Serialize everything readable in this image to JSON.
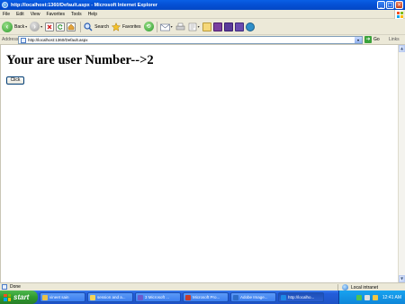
{
  "window": {
    "title": "http://localhost:1360/Default.aspx - Microsoft Internet Explorer",
    "buttons": [
      "_",
      "□",
      "×"
    ]
  },
  "menu": {
    "items": [
      "File",
      "Edit",
      "View",
      "Favorites",
      "Tools",
      "Help"
    ]
  },
  "toolbar": {
    "back_label": "Back",
    "search_label": "Search",
    "favorites_label": "Favorites"
  },
  "address": {
    "label": "Address",
    "url": "http://localhost:1360/Default.aspx",
    "go_label": "Go",
    "links_label": "Links"
  },
  "page": {
    "heading": "Your are user Number-->2",
    "button_label": "Click"
  },
  "statusbar": {
    "status": "Done",
    "zone": "Local intranet"
  },
  "taskbar": {
    "start_label": "start",
    "tasks": [
      {
        "label": "vineet sain",
        "color": "#e8c24a",
        "active": false
      },
      {
        "label": "session and a...",
        "color": "#f3d45a",
        "active": false
      },
      {
        "label": "3 Microsoft ...",
        "color": "#6a5acd",
        "active": false
      },
      {
        "label": "Microsoft Pro...",
        "color": "#c43c2c",
        "active": false
      },
      {
        "label": "Adobe Image...",
        "color": "#2d6cc6",
        "active": false
      },
      {
        "label": "http://localho...",
        "color": "#1e88e5",
        "active": true
      }
    ],
    "clock": "12:41 AM"
  },
  "colors": {
    "titlebar": "#0551d6",
    "chrome": "#ece9d8",
    "taskbar": "#245edb",
    "start": "#2f9a2f"
  }
}
